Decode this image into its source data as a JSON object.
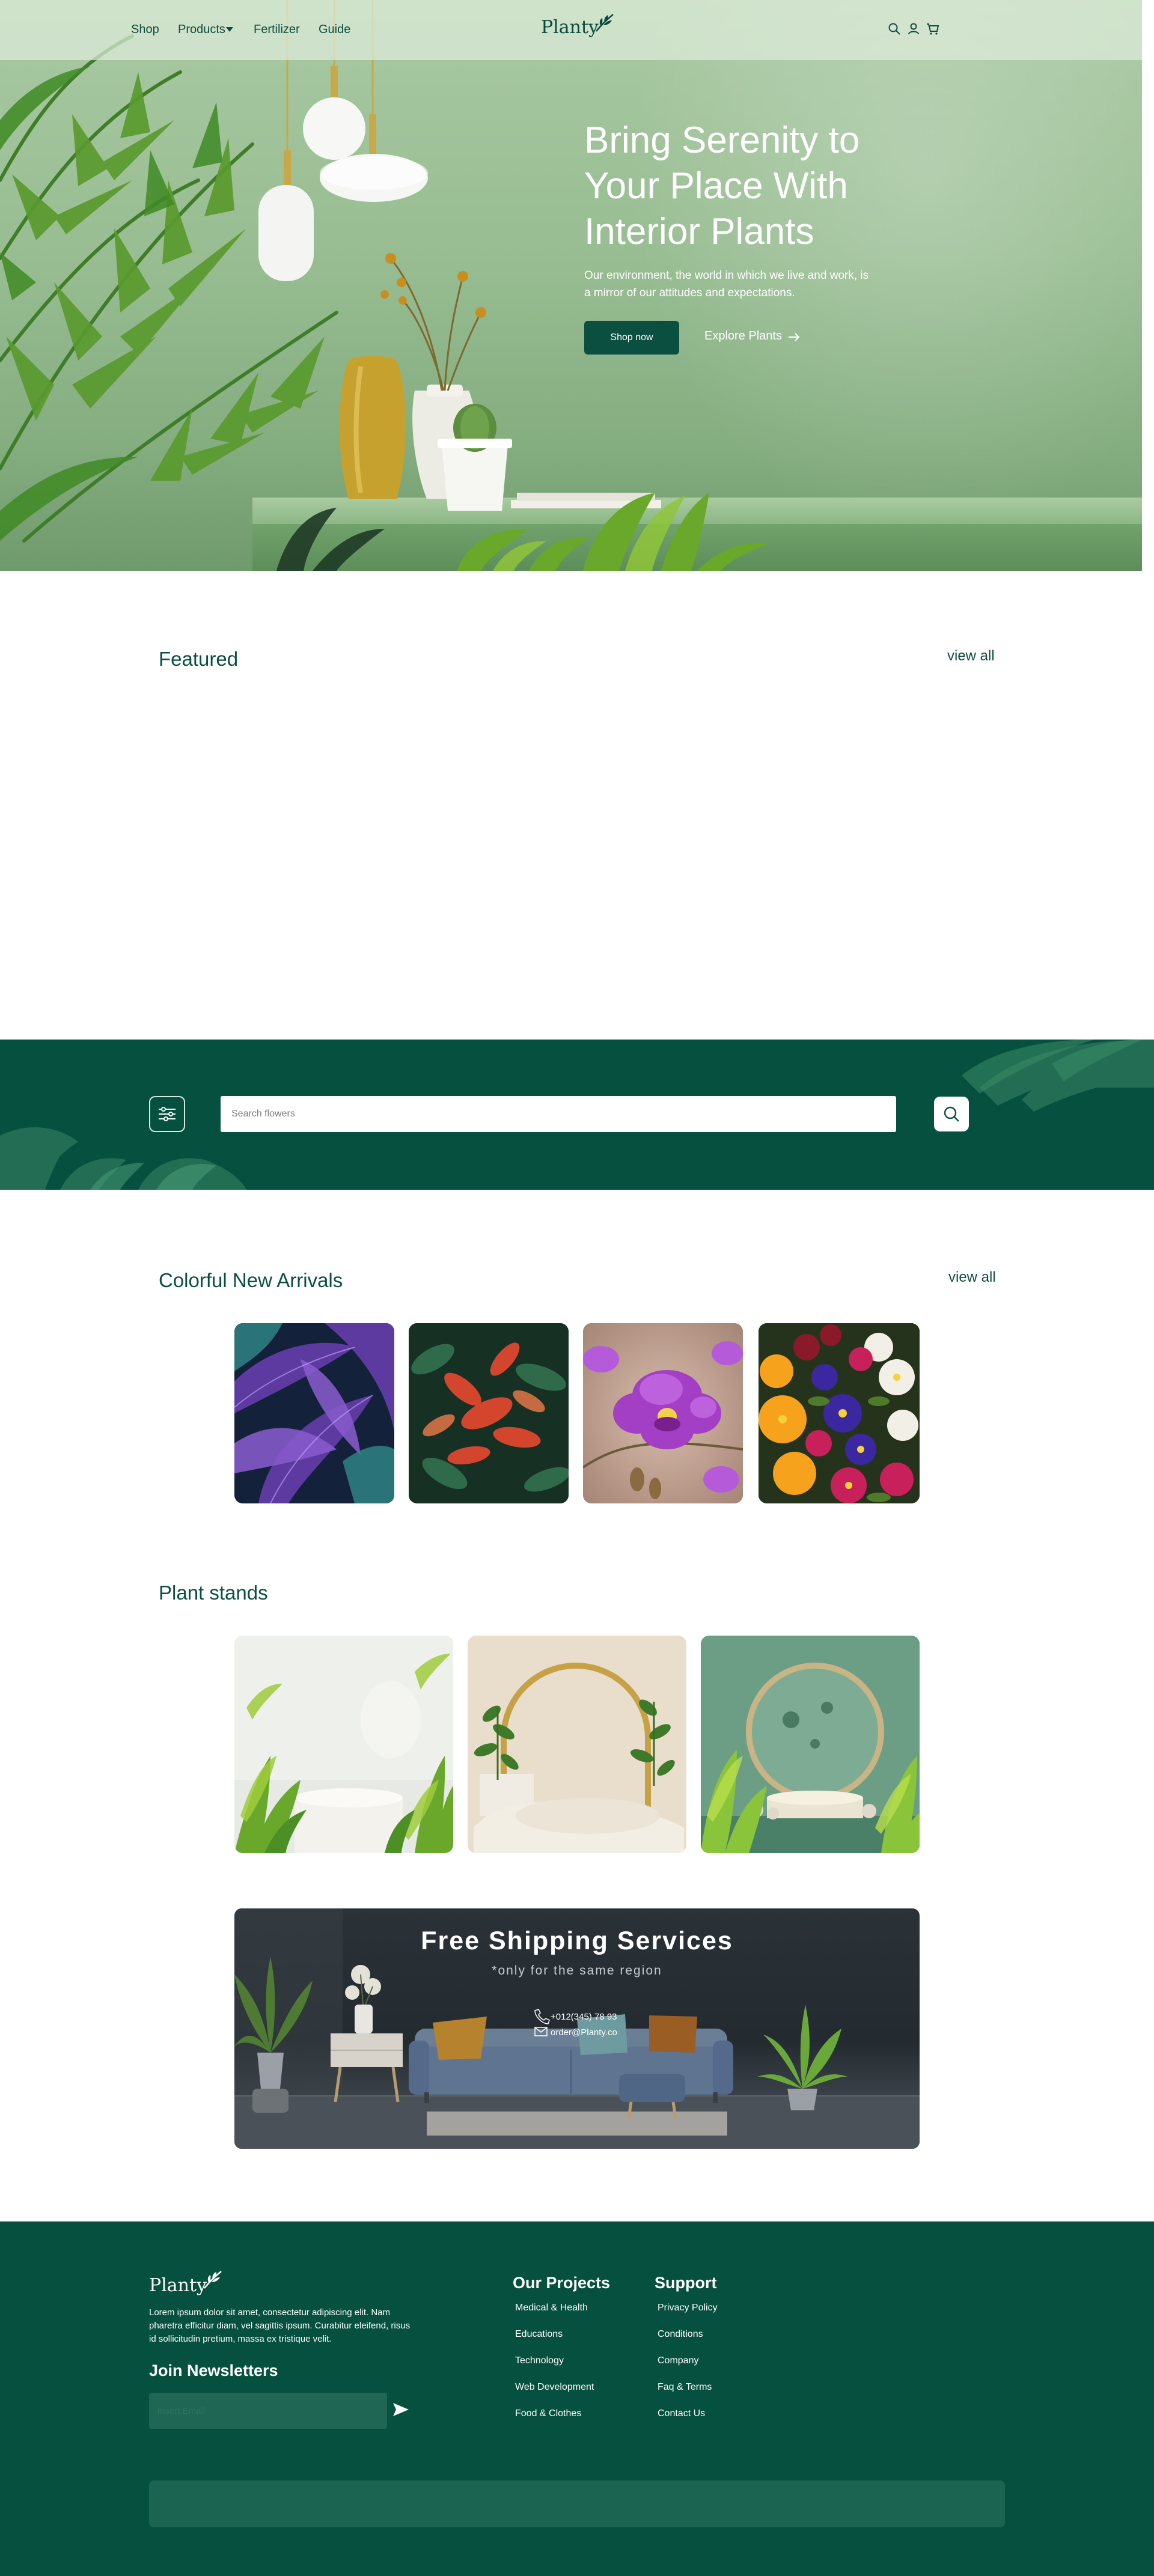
{
  "nav": {
    "links": [
      "Shop",
      "Products",
      "Fertilizer",
      "Guide"
    ],
    "logo": "Planty"
  },
  "hero": {
    "title": "Bring Serenity to Your Place With Interior Plants",
    "subtitle": "Our environment, the world in which we live and work, is a mirror of our attitudes and expectations.",
    "primary_cta": "Shop now",
    "secondary_cta": "Explore Plants"
  },
  "featured": {
    "title": "Featured",
    "view_all": "view all"
  },
  "search": {
    "placeholder": "Search flowers"
  },
  "arrivals": {
    "title": "Colorful New Arrivals",
    "view_all": "view all"
  },
  "stands": {
    "title": "Plant stands"
  },
  "shipping": {
    "title": "Free Shipping Services",
    "subtitle": "*only for the same region",
    "phone": "+012(345) 78 93",
    "email": "order@Planty.co"
  },
  "footer": {
    "logo": "Planty",
    "description": "Lorem ipsum dolor sit amet, consectetur adipiscing elit. Nam pharetra efficitur diam, vel sagittis ipsum. Curabitur eleifend, risus id sollicitudin pretium, massa ex tristique velit.",
    "newsletter_title": "Join Newsletters",
    "newsletter_placeholder": "Insert Email",
    "projects": {
      "title": "Our Projects",
      "links": [
        "Medical & Health",
        "Educations",
        "Technology",
        "Web Development",
        "Food & Clothes"
      ]
    },
    "support": {
      "title": "Support",
      "links": [
        "Privacy Policy",
        "Conditions",
        "Company",
        "Faq & Terms",
        "Contact Us"
      ]
    }
  },
  "colors": {
    "brand_green": "#06503f",
    "button_green": "#0b4f40",
    "hero_sage": "#98bd92"
  }
}
